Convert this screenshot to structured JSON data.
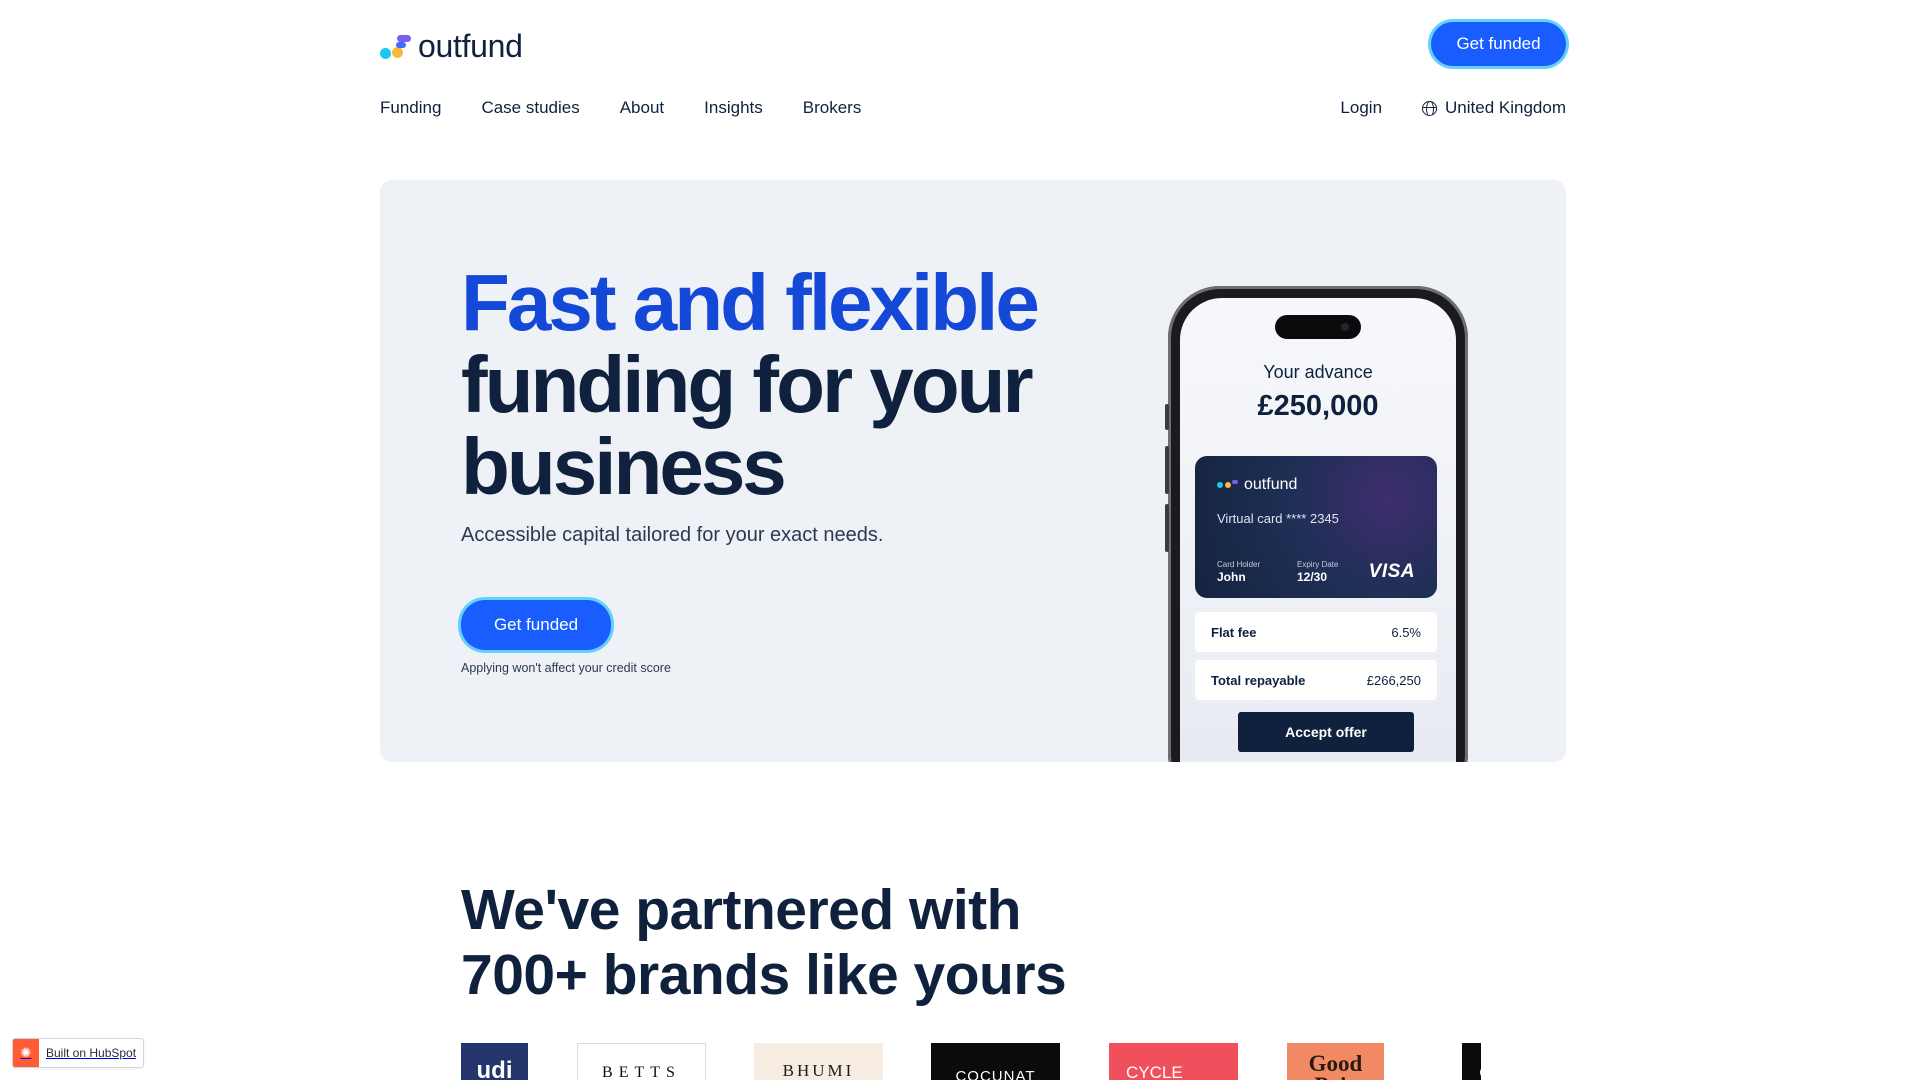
{
  "header": {
    "logo_text": "outfund",
    "cta_label": "Get funded",
    "nav": [
      "Funding",
      "Case studies",
      "About",
      "Insights",
      "Brokers"
    ],
    "login_label": "Login",
    "country_label": "United Kingdom"
  },
  "hero": {
    "title_accent": "Fast and flexible",
    "title_line2": "funding for your",
    "title_line3": "business",
    "subtitle": "Accessible capital tailored for your exact needs.",
    "cta_label": "Get funded",
    "note": "Applying won't affect your credit score"
  },
  "phone": {
    "advance_label": "Your advance",
    "advance_value": "£250,000",
    "card": {
      "logo_text": "outfund",
      "number": "Virtual card **** 2345",
      "holder_label": "Card Holder",
      "holder_value": "John",
      "expiry_label": "Expiry Date",
      "expiry_value": "12/30",
      "brand": "VISA"
    },
    "rows": [
      {
        "label": "Flat fee",
        "value": "6.5%"
      },
      {
        "label": "Total repayable",
        "value": "£266,250"
      }
    ],
    "accept_label": "Accept offer"
  },
  "partners": {
    "title_line1": "We've partnered with",
    "title_line2": "700+ brands like yours",
    "brands": [
      "udi",
      "BETTS",
      "BHUMI",
      "COCUNAT",
      "CYCLE EXCHANGE",
      "Good Pair",
      "C"
    ]
  },
  "badge": {
    "label": "Built on HubSpot"
  },
  "colors": {
    "primary": "#1a5dff",
    "accent_headline": "#1448d6",
    "navy": "#0f213d",
    "hero_bg": "#eef1f6"
  }
}
